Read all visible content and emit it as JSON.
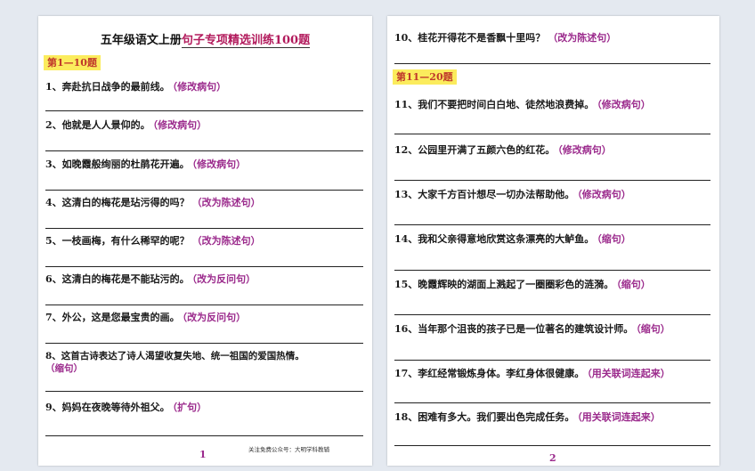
{
  "document": {
    "title_main": "五年级语文上册",
    "title_accent": "句子专项精选训练100题",
    "footer_note": "关注免费公众号：大明学科教辅"
  },
  "page1": {
    "section": "第1—10题",
    "number": "1",
    "questions": [
      {
        "text": "1、奔赴抗日战争的最前线。",
        "req": "（修改病句）"
      },
      {
        "text": "2、他就是人人景仰的。",
        "req": "（修改病句）"
      },
      {
        "text": "3、如晚霞般绚丽的杜鹃花开遍。",
        "req": "（修改病句）"
      },
      {
        "text": "4、这清白的梅花是玷污得的吗？",
        "req": "（改为陈述句）"
      },
      {
        "text": "5、一枝画梅，有什么稀罕的呢？",
        "req": "（改为陈述句）"
      },
      {
        "text": "6、这清白的梅花是不能玷污的。",
        "req": "（改为反问句）"
      },
      {
        "text": "7、外公，这是您最宝贵的画。",
        "req": "（改为反问句）"
      },
      {
        "text": "8、这首古诗表达了诗人渴望收复失地、统一祖国的爱国热情。",
        "req": "（缩句）"
      },
      {
        "text": "9、妈妈在夜晚等待外祖父。",
        "req": "（扩句）"
      }
    ]
  },
  "page2": {
    "section": "第11—20题",
    "number": "2",
    "questions": [
      {
        "text": "10、桂花开得花不是香飘十里吗？",
        "req": "（改为陈述句）"
      },
      {
        "text": "11、我们不要把时间白白地、徒然地浪费掉。",
        "req": "（修改病句）"
      },
      {
        "text": "12、公园里开满了五颜六色的红花。",
        "req": "（修改病句）"
      },
      {
        "text": "13、大家千方百计想尽一切办法帮助他。",
        "req": "（修改病句）"
      },
      {
        "text": "14、我和父亲得意地欣赏这条漂亮的大鲈鱼。",
        "req": "（缩句）"
      },
      {
        "text": "15、晚霞辉映的湖面上溅起了一圈圈彩色的涟漪。",
        "req": "（缩句）"
      },
      {
        "text": "16、当年那个沮丧的孩子已是一位著名的建筑设计师。",
        "req": "（缩句）"
      },
      {
        "text": "17、李红经常锻炼身体。李红身体很健康。",
        "req": "（用关联词连起来）"
      },
      {
        "text": "18、困难有多大。我们要出色完成任务。",
        "req": "（用关联词连起来）"
      }
    ]
  }
}
